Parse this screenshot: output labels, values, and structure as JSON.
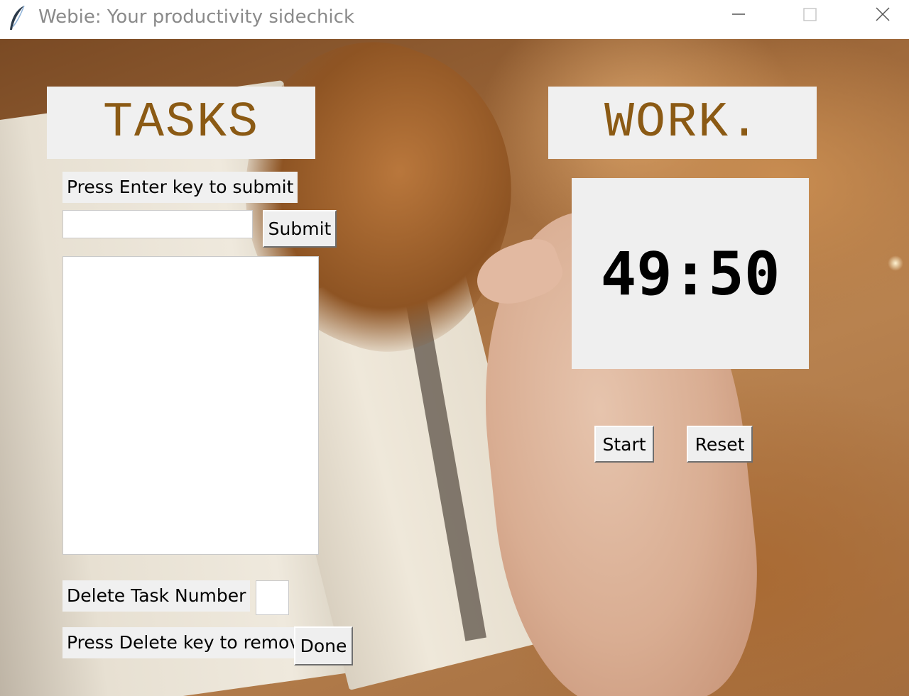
{
  "window": {
    "title": "Webie: Your productivity sidechick",
    "app_icon": "feather-icon",
    "controls": [
      "minimize-icon",
      "maximize-icon",
      "close-icon"
    ]
  },
  "tasks": {
    "heading": "TASKS",
    "submit_hint": "Press Enter key to submit",
    "input_value": "",
    "submit_label": "Submit",
    "items": [],
    "delete_label": "Delete Task Number",
    "delete_value": "",
    "delete_hint": "Press Delete key to remove",
    "done_label": "Done"
  },
  "work": {
    "heading": "WORK.",
    "timer": "49:50",
    "start_label": "Start",
    "reset_label": "Reset"
  },
  "colors": {
    "heading_text": "#8b5a14",
    "widget_bg": "#f0f0f0",
    "timer_text": "#000000"
  }
}
